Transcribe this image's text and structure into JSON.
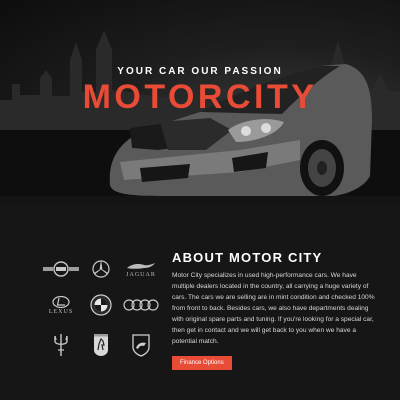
{
  "hero": {
    "tagline": "YOUR CAR OUR PASSION",
    "brand": "MOTORCITY",
    "accent_color": "#e84c36"
  },
  "about": {
    "title": "ABOUT MOTOR CITY",
    "text": "Motor City specializes in used high-performance cars. We have multiple dealers located in the country, all carrying a huge variety of cars. The cars we are selling are in mint condition and checked 100% from front to back. Besides cars, we also have departments dealing with original spare parts and tuning. If you're looking for a special car, then get in contact and we will get back to you when we have a potential match.",
    "button_label": "Finance Options",
    "logos": [
      {
        "name": "mini",
        "icon": "mini-logo-icon"
      },
      {
        "name": "mercedes",
        "icon": "mercedes-logo-icon"
      },
      {
        "name": "jaguar",
        "icon": "jaguar-logo-icon",
        "wordmark": "JAGUAR"
      },
      {
        "name": "lexus",
        "icon": "lexus-logo-icon",
        "wordmark": "LEXUS"
      },
      {
        "name": "bmw",
        "icon": "bmw-logo-icon"
      },
      {
        "name": "audi",
        "icon": "audi-logo-icon"
      },
      {
        "name": "maserati",
        "icon": "maserati-logo-icon"
      },
      {
        "name": "ferrari",
        "icon": "ferrari-logo-icon"
      },
      {
        "name": "lamborghini",
        "icon": "lamborghini-logo-icon"
      }
    ]
  }
}
